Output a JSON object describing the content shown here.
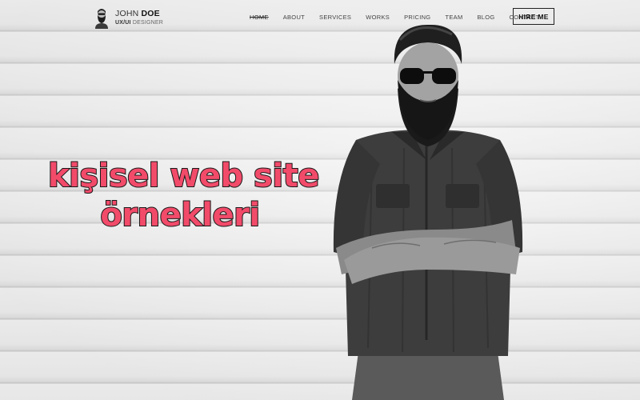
{
  "brand": {
    "first_name": "JOHN",
    "last_name": "DOE",
    "role_prefix": "UX/UI",
    "role_suffix": "DESIGNER"
  },
  "nav": {
    "items": [
      {
        "label": "HOME",
        "active": true
      },
      {
        "label": "ABOUT"
      },
      {
        "label": "SERVICES"
      },
      {
        "label": "WORKS"
      },
      {
        "label": "PRICING"
      },
      {
        "label": "TEAM"
      },
      {
        "label": "BLOG"
      },
      {
        "label": "CONTACT"
      }
    ],
    "cta_label": "HIRE ME"
  },
  "hero": {
    "headline_line1": "kişisel web site",
    "headline_line2": "örnekleri",
    "headline_color": "#f24b6a"
  }
}
